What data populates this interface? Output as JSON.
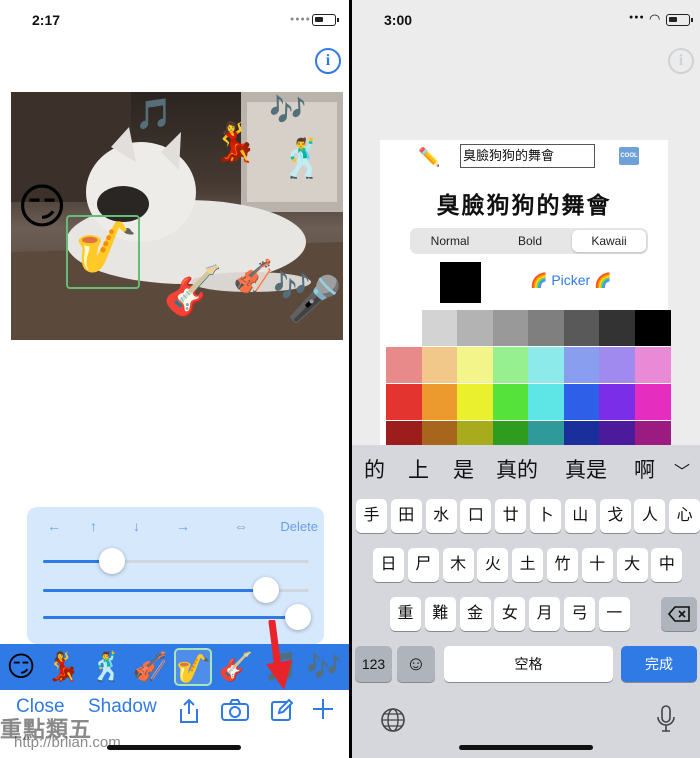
{
  "left": {
    "time": "2:17",
    "info_glyph": "i",
    "stickers": [
      {
        "name": "smirking-face-sticker",
        "glyph": "😏"
      },
      {
        "name": "musical-note-sticker",
        "glyph": "🎵"
      },
      {
        "name": "dancer-woman-sticker",
        "glyph": "💃"
      },
      {
        "name": "musical-notes-sticker",
        "glyph": "🎶"
      },
      {
        "name": "dancer-man-sticker",
        "glyph": "🕺"
      },
      {
        "name": "saxophone-sticker",
        "glyph": "🎷"
      },
      {
        "name": "guitar-sticker",
        "glyph": "🎸"
      },
      {
        "name": "violin-sticker",
        "glyph": "🎻"
      },
      {
        "name": "musical-notes-sticker-2",
        "glyph": "🎶"
      },
      {
        "name": "microphone-sticker",
        "glyph": "🎤"
      }
    ],
    "panel": {
      "arrows": [
        "←",
        "↑",
        "↓",
        "→",
        "⇔"
      ],
      "delete_label": "Delete",
      "sliders": [
        0.26,
        0.84,
        0.96
      ]
    },
    "tray": [
      "😏",
      "💃",
      "🕺",
      "🎻",
      "🎷",
      "🎸",
      "🎵",
      "🎶"
    ],
    "tray_selected": 4,
    "toolbar": {
      "close_label": "Close",
      "shadow_label": "Shadow"
    },
    "watermark": "重點類五",
    "watermark_url": "http://briian.com",
    "colors": {
      "accent": "#2f7ae5",
      "arrow": "#e8242a"
    }
  },
  "right": {
    "time": "3:00",
    "text_field_value": "臭臉狗狗的舞會",
    "cool_badge": "COOL",
    "title": "臭臉狗狗的舞會",
    "segments": [
      "Normal",
      "Bold",
      "Kawaii"
    ],
    "segment_selected": 2,
    "picker_label": "🌈 Picker 🌈",
    "palette": [
      [
        "#ffffff",
        "#d3d3d3",
        "#b3b3b3",
        "#999999",
        "#7f7f7f",
        "#595959",
        "#333333",
        "#000000"
      ],
      [
        "#e98a8a",
        "#f1c88a",
        "#f3f58a",
        "#96f08f",
        "#8deaea",
        "#8a9ef0",
        "#a08af0",
        "#ea8ad7"
      ],
      [
        "#e3342f",
        "#ec9a2e",
        "#eaf02e",
        "#55e23a",
        "#5ee5e5",
        "#2e5fe8",
        "#7a2ee8",
        "#e52ec0"
      ],
      [
        "#9c1d1c",
        "#a8661c",
        "#a8ab1c",
        "#2e9c1f",
        "#2e9a9a",
        "#1b2f9c",
        "#4b1b9c",
        "#9c1b80"
      ]
    ],
    "candidates": [
      "的",
      "上",
      "是",
      "真的",
      "真是",
      "啊"
    ],
    "candidates_chevron": "﹀",
    "kb_rows": [
      [
        "手",
        "田",
        "水",
        "口",
        "廿",
        "卜",
        "山",
        "戈",
        "人",
        "心"
      ],
      [
        "日",
        "尸",
        "木",
        "火",
        "土",
        "竹",
        "十",
        "大",
        "中"
      ],
      [
        "重",
        "難",
        "金",
        "女",
        "月",
        "弓",
        "一"
      ]
    ],
    "kb_123": "123",
    "kb_emoji": "☺",
    "kb_space": "空格",
    "kb_done": "完成"
  }
}
